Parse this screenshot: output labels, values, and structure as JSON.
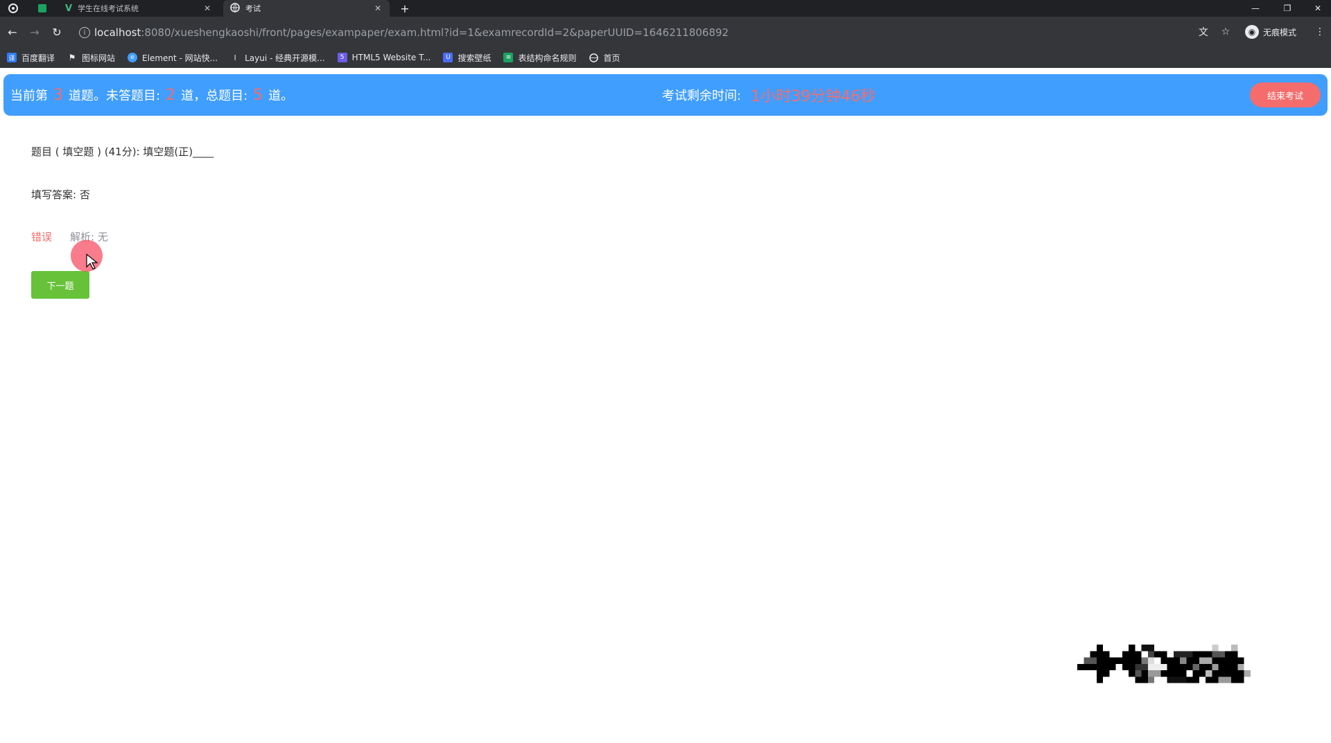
{
  "browser": {
    "tabs": [
      {
        "title": "学生在线考试系统",
        "active": false,
        "icon": "vue-icon"
      },
      {
        "title": "考试",
        "active": true,
        "icon": "globe-icon"
      }
    ],
    "url_host": "localhost",
    "url_rest": ":8080/xueshengkaoshi/front/pages/exampaper/exam.html?id=1&examrecordId=2&paperUUID=1646211806892",
    "profile_label": "无痕模式",
    "bookmarks": [
      {
        "label": "百度翻译",
        "icon": "translate-icon",
        "color": "#2f7cf6"
      },
      {
        "label": "图标网站",
        "icon": "flag-icon",
        "color": "#5f6368"
      },
      {
        "label": "Element - 网站快...",
        "icon": "element-icon",
        "color": "#409eff"
      },
      {
        "label": "Layui - 经典开源模...",
        "icon": "layui-icon",
        "color": "#5f6368"
      },
      {
        "label": "HTML5 Website T...",
        "icon": "html5-icon",
        "color": "#6c5ce7"
      },
      {
        "label": "搜索壁纸",
        "icon": "wallpaper-icon",
        "color": "#4a6cf7"
      },
      {
        "label": "表结构命名规则",
        "icon": "doc-icon",
        "color": "#1aa260"
      },
      {
        "label": "首页",
        "icon": "globe-icon",
        "color": "#5f6368"
      }
    ]
  },
  "exam": {
    "current_prefix": "当前第",
    "current_num": "3",
    "current_suffix": "道题。未答题目:",
    "unanswered_num": "2",
    "unanswered_suffix": "道，总题目:",
    "total_num": "5",
    "total_suffix": "道。",
    "time_label": "考试剩余时间:",
    "time_value": "1小时39分钟46秒",
    "end_button": "结束考试",
    "question": "题目 ( 填空题 ) (41分):  填空题(正)____",
    "answer": "填写答案:  否",
    "result": "错误",
    "analysis": "解析:  无",
    "next_button": "下一题"
  },
  "colors": {
    "header_bg": "#409eff",
    "accent_red": "#f56c6c",
    "next_green": "#67c23a"
  }
}
